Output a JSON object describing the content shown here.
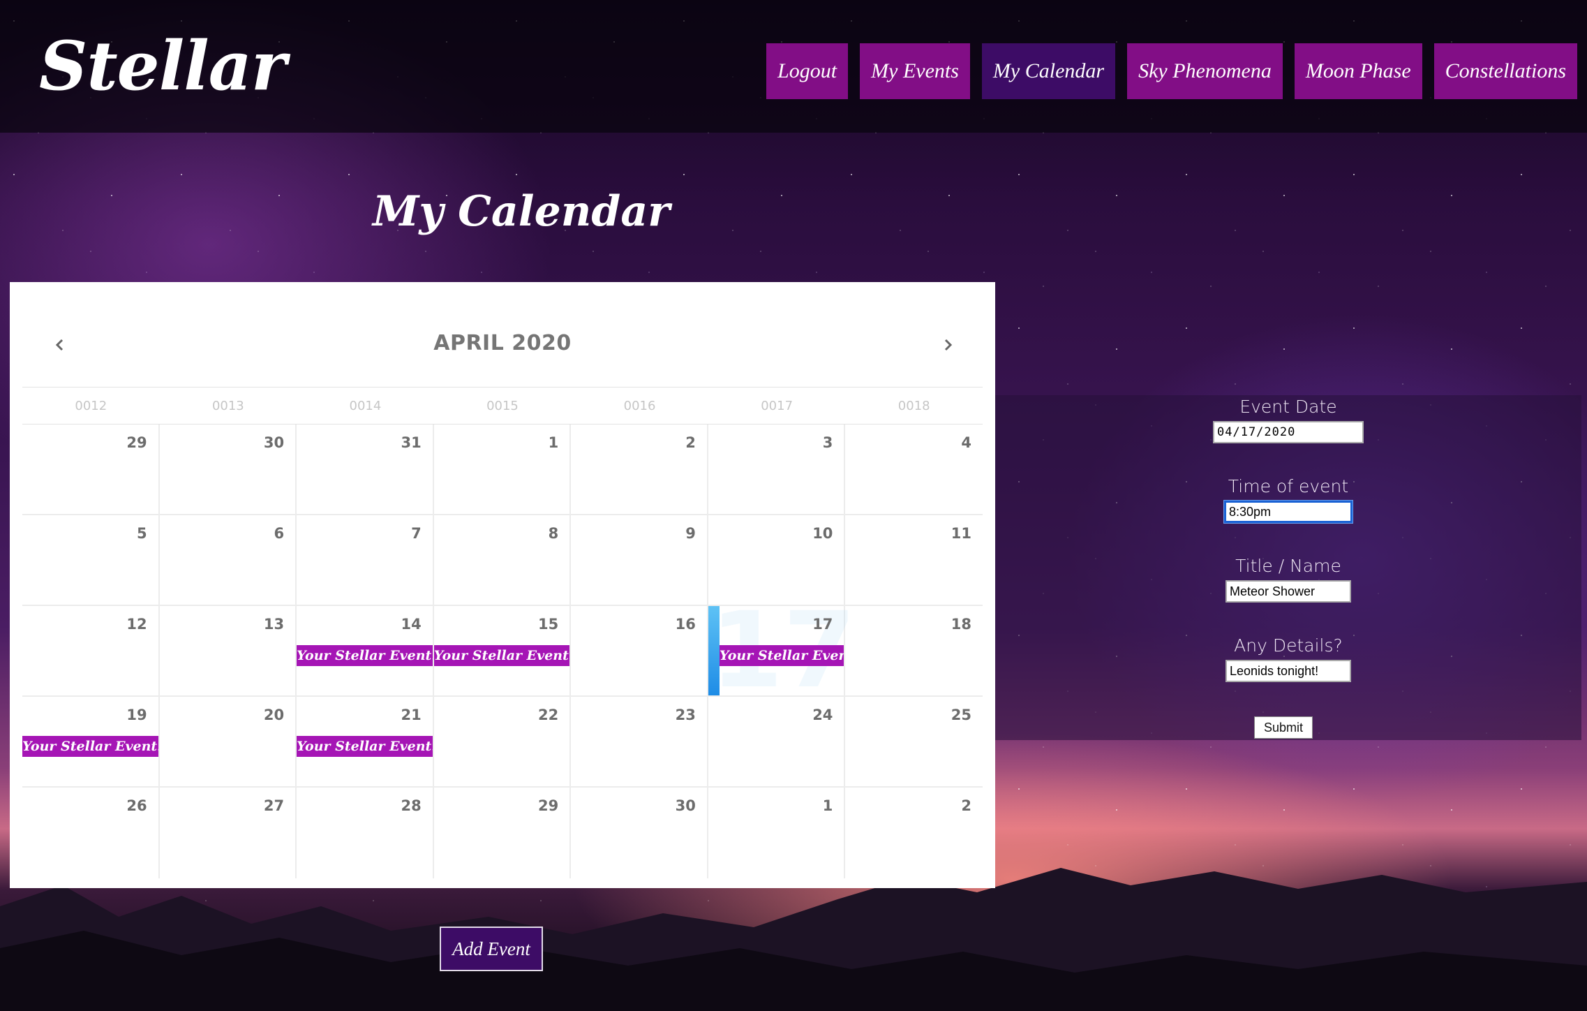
{
  "header": {
    "logo": "Stellar",
    "nav": [
      {
        "label": "Logout",
        "active": false
      },
      {
        "label": "My Events",
        "active": false
      },
      {
        "label": "My Calendar",
        "active": true
      },
      {
        "label": "Sky Phenomena",
        "active": false
      },
      {
        "label": "Moon Phase",
        "active": false
      },
      {
        "label": "Constellations",
        "active": false
      }
    ]
  },
  "page_title": "My Calendar",
  "calendar": {
    "month_label": "APRIL 2020",
    "prev_icon": "chevron-left-icon",
    "next_icon": "chevron-right-icon",
    "weekdays": [
      "0012",
      "0013",
      "0014",
      "0015",
      "0016",
      "0017",
      "0018"
    ],
    "today": "17",
    "event_label": "Your Stellar Event!",
    "weeks": [
      [
        {
          "day": "29"
        },
        {
          "day": "30"
        },
        {
          "day": "31"
        },
        {
          "day": "1"
        },
        {
          "day": "2"
        },
        {
          "day": "3"
        },
        {
          "day": "4"
        }
      ],
      [
        {
          "day": "5"
        },
        {
          "day": "6"
        },
        {
          "day": "7"
        },
        {
          "day": "8"
        },
        {
          "day": "9"
        },
        {
          "day": "10"
        },
        {
          "day": "11"
        }
      ],
      [
        {
          "day": "12"
        },
        {
          "day": "13"
        },
        {
          "day": "14",
          "event": "Your Stellar Event!"
        },
        {
          "day": "15",
          "event": "Your Stellar Event!"
        },
        {
          "day": "16"
        },
        {
          "day": "17",
          "today": true,
          "event": "Your Stellar Event!"
        },
        {
          "day": "18"
        }
      ],
      [
        {
          "day": "19",
          "event": "Your Stellar Event!"
        },
        {
          "day": "20"
        },
        {
          "day": "21",
          "event": "Your Stellar Event!"
        },
        {
          "day": "22"
        },
        {
          "day": "23"
        },
        {
          "day": "24"
        },
        {
          "day": "25"
        }
      ],
      [
        {
          "day": "26"
        },
        {
          "day": "27"
        },
        {
          "day": "28"
        },
        {
          "day": "29"
        },
        {
          "day": "30"
        },
        {
          "day": "1"
        },
        {
          "day": "2"
        }
      ]
    ]
  },
  "form": {
    "event_date_label": "Event Date",
    "event_date_value": "04/17/2020",
    "time_label": "Time of event",
    "time_value": "8:30pm",
    "title_label": "Title / Name",
    "title_value": "Meteor Shower",
    "details_label": "Any Details?",
    "details_value": "Leonids tonight!",
    "submit_label": "Submit"
  },
  "add_event_label": "Add Event",
  "colors": {
    "nav_bg": "#820e86",
    "nav_active_bg": "#3d0c66",
    "event_bg": "#a515b5",
    "today_accent": "#1e8ce6"
  }
}
